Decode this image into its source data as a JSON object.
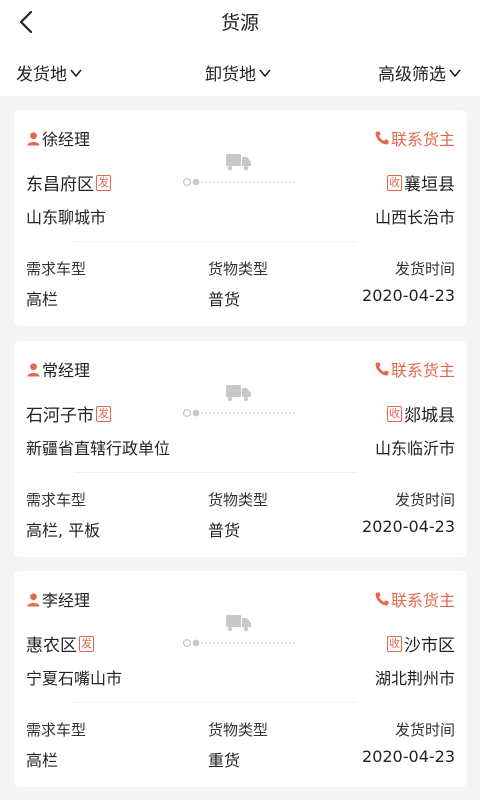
{
  "header": {
    "title": "货源"
  },
  "filters": [
    {
      "label": "发货地"
    },
    {
      "label": "卸货地"
    },
    {
      "label": "高级筛选"
    }
  ],
  "labels": {
    "vehicle_type": "需求车型",
    "cargo_type": "货物类型",
    "ship_date": "发货时间",
    "contact": "联系货主",
    "from_tag": "发",
    "to_tag": "收"
  },
  "colors": {
    "accent": "#e2694e",
    "icon_gray": "#c8c8c8"
  },
  "cards": [
    {
      "name": "徐经理",
      "from_district": "东昌府区",
      "from_city": "山东聊城市",
      "to_district": "襄垣县",
      "to_city": "山西长治市",
      "vehicle_type": "高栏",
      "cargo_type": "普货",
      "ship_date": "2020-04-23"
    },
    {
      "name": "常经理",
      "from_district": "石河子市",
      "from_city": "新疆省直辖行政单位",
      "to_district": "郯城县",
      "to_city": "山东临沂市",
      "vehicle_type": "高栏, 平板",
      "cargo_type": "普货",
      "ship_date": "2020-04-23"
    },
    {
      "name": "李经理",
      "from_district": "惠农区",
      "from_city": "宁夏石嘴山市",
      "to_district": "沙市区",
      "to_city": "湖北荆州市",
      "vehicle_type": "高栏",
      "cargo_type": "重货",
      "ship_date": "2020-04-23"
    }
  ]
}
